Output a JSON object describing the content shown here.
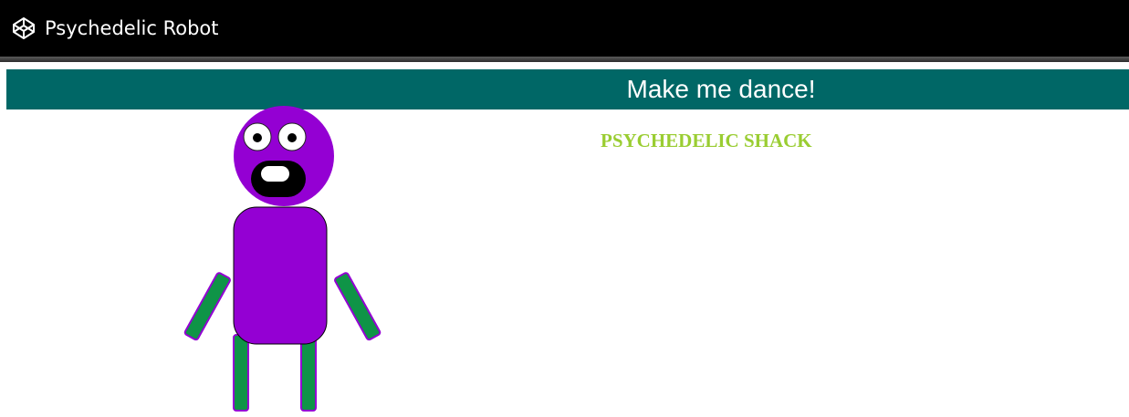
{
  "header": {
    "title": "Psychedelic Robot",
    "logo_icon": "codepen-cube-icon"
  },
  "dance_button": {
    "label": "Make me dance!"
  },
  "shack": {
    "text": "PSYCHEDELIC SHACK"
  },
  "colors": {
    "header_bg": "#000000",
    "dance_bar": "#006766",
    "robot_body": "#9400d3",
    "robot_limbs": "#0f9447",
    "shack_text": "#9acd32"
  }
}
